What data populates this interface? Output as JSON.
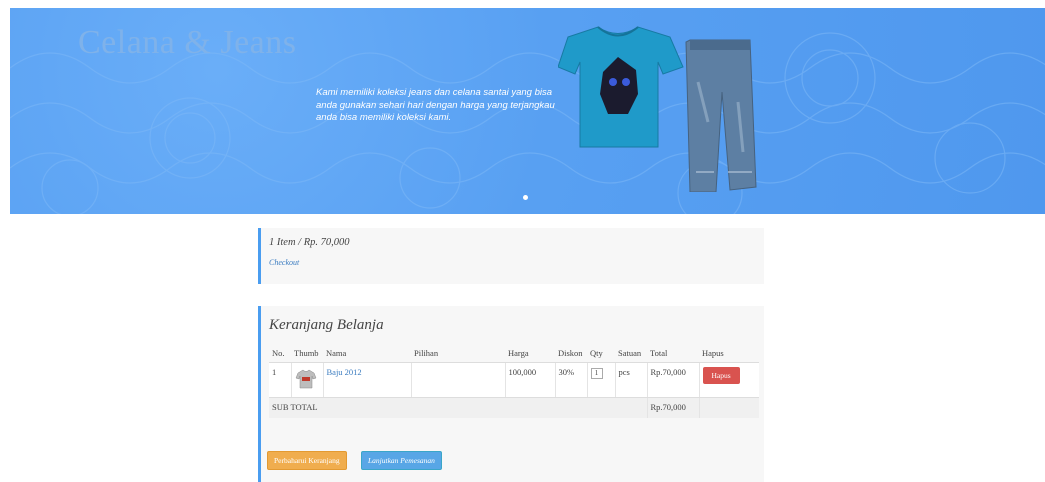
{
  "banner": {
    "title": "Celana & Jeans",
    "description": "Kami memiliki koleksi jeans dan celana santai yang bisa anda gunakan sehari hari dengan harga yang terjangkau anda bisa memiliki koleksi kami."
  },
  "summary": {
    "text": "1 Item / Rp. 70,000",
    "checkout_label": "Checkout"
  },
  "cart": {
    "title": "Keranjang Belanja",
    "headers": [
      "No.",
      "Thumb",
      "Nama",
      "Pilihan",
      "Harga",
      "Diskon",
      "Qty",
      "Satuan",
      "Total",
      "Hapus"
    ],
    "rows": [
      {
        "no": "1",
        "name": "Baju 2012",
        "option": "",
        "price": "100,000",
        "discount": "30%",
        "qty": "1",
        "unit": "pcs",
        "total": "Rp.70,000",
        "delete_label": "Hapus"
      }
    ],
    "subtotal_label": "SUB TOTAL",
    "subtotal_value": "Rp.70,000",
    "update_button": "Perbaharui Keranjang",
    "continue_button": "Lanjutkan Pemesanan"
  },
  "colors": {
    "banner_blue": "#58a0f2",
    "accent_blue": "#4a9df0",
    "delete_red": "#d9534f",
    "update_orange": "#f0ad4e"
  }
}
